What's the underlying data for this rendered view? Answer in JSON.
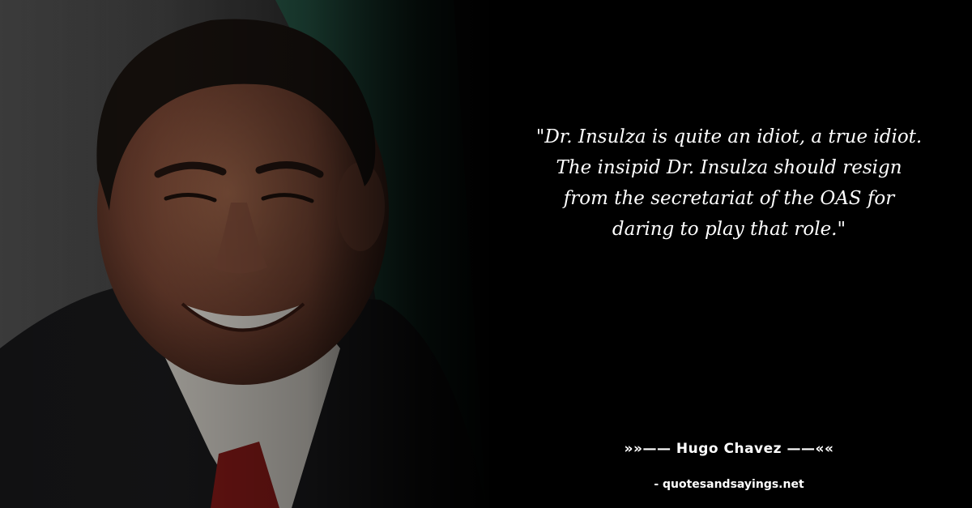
{
  "quote": {
    "text": "\"Dr. Insulza is quite an idiot, a true idiot. The insipid Dr. Insulza should resign from the secretariat of the OAS for daring to play that role.\""
  },
  "attribution": {
    "author_line": "»»—— Hugo Chavez ——««"
  },
  "watermark": {
    "source": "- quotesandsayings.net"
  },
  "colors": {
    "background": "#000000",
    "text": "#ffffff",
    "flag_green": "#1f5a48",
    "tie_red": "#8a1a18"
  }
}
